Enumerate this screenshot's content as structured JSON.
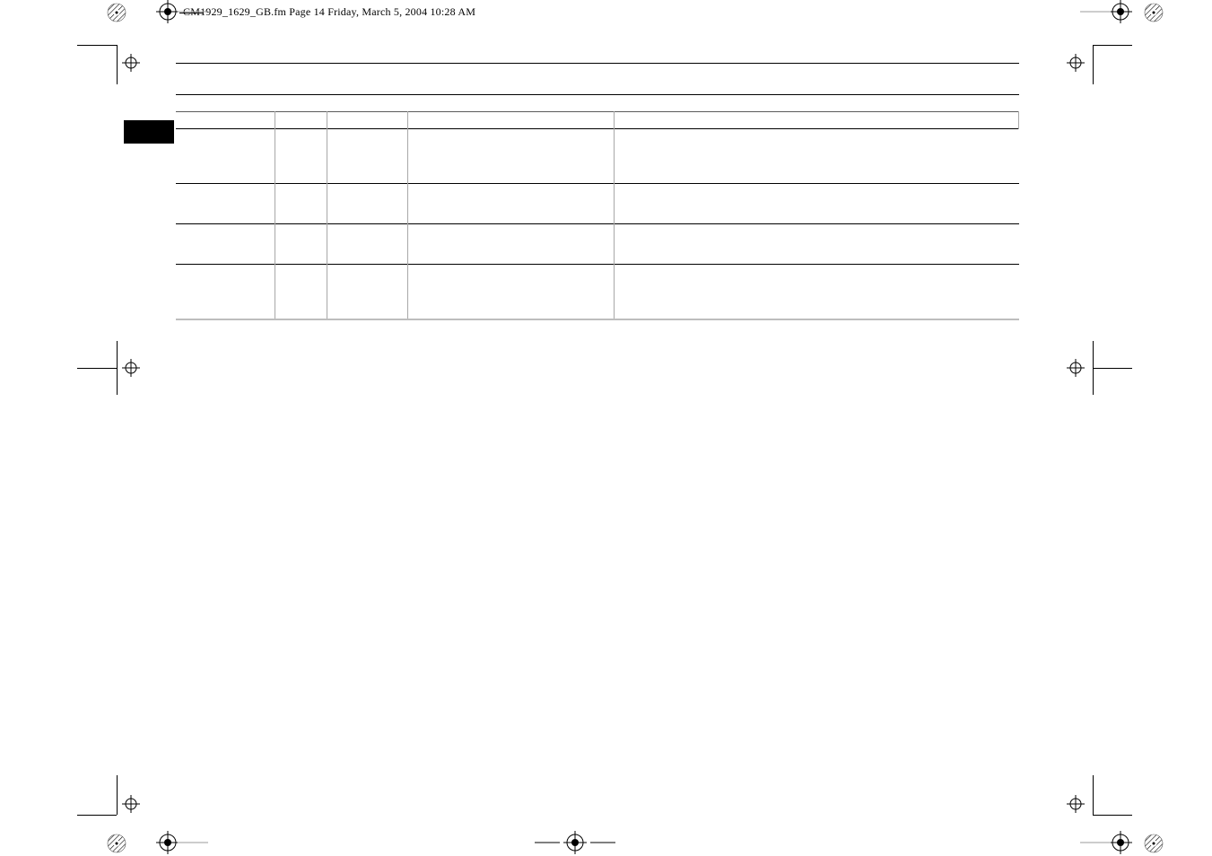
{
  "file_header": {
    "filename_prefix": "CM",
    "filename_rest": "1929_1629_GB.fm  Page 14  Friday, March 5, 2004  10:28 AM"
  },
  "colors": {
    "cyan": "#6bb7c4",
    "magenta": "#c59aa8",
    "yellow": "#c8c487",
    "black": "#000000"
  },
  "marks": {
    "corner_target": "registration-target-icon",
    "side_target": "registration-target-icon",
    "color_patch": "color-patch-icon"
  }
}
